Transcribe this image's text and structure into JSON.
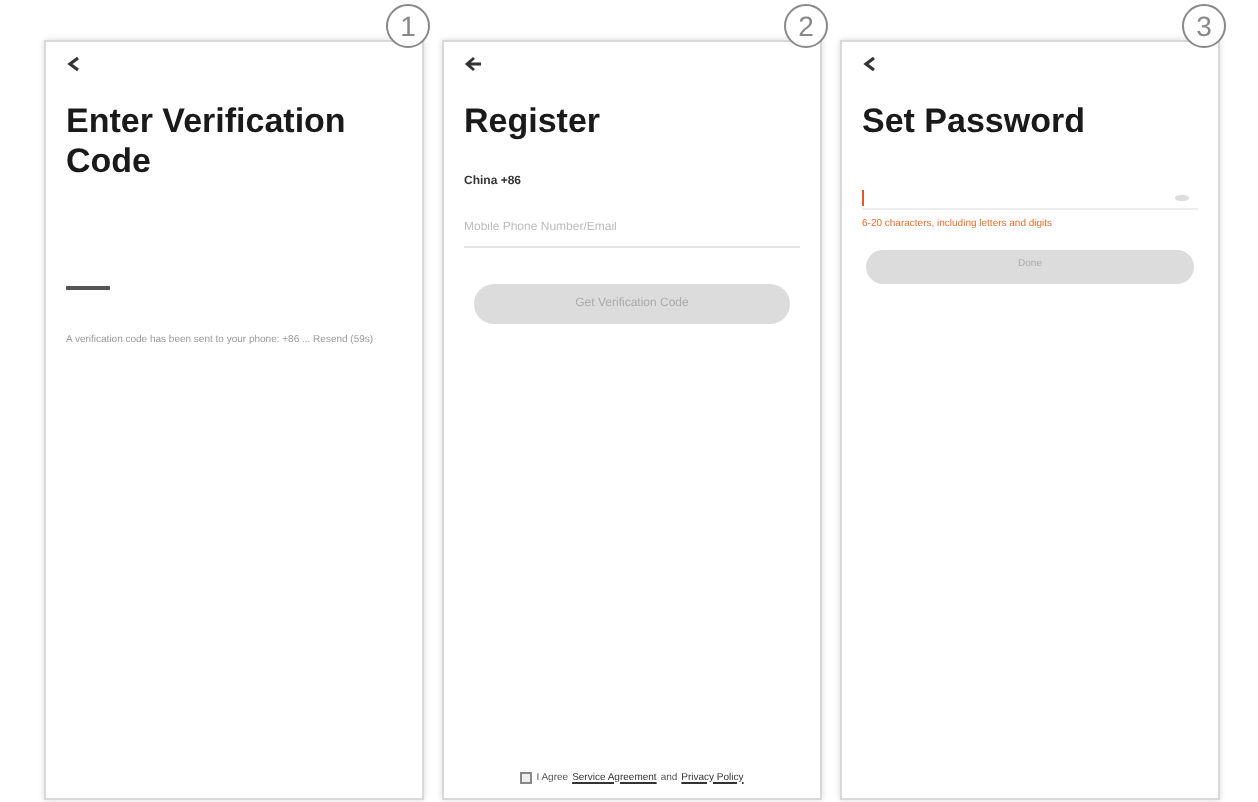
{
  "screens": [
    {
      "kind": "verify",
      "number": "1",
      "title": "Enter Verification Code",
      "note": "A verification code has been sent to your phone: +86 ... Resend (59s)"
    },
    {
      "kind": "register",
      "number": "2",
      "title": "Register",
      "country": "China +86",
      "placeholder": "Mobile Phone Number/Email",
      "button": "Get Verification Code",
      "agree_prefix": "I Agree",
      "agree_link_1": "Service Agreement",
      "agree_and": "and",
      "agree_link_2": "Privacy Policy",
      "agreed": false
    },
    {
      "kind": "password",
      "number": "3",
      "title": "Set Password",
      "hint": "6-20 characters, including letters and digits",
      "button": "Done"
    }
  ]
}
